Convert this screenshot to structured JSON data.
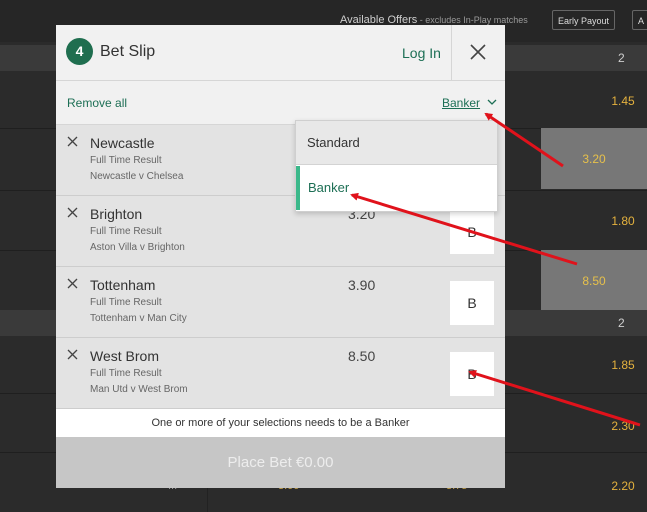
{
  "background": {
    "offers_label": "Available Offers",
    "offers_sub": " - excludes In-Play matches",
    "early_payout": "Early Payout",
    "edge_button": "A",
    "header_col": "2",
    "odds_rows": [
      "1.45",
      "3.20",
      "1.80",
      "8.50",
      "1.85",
      "2.30",
      "2.20"
    ],
    "bottom_fragments": [
      "...",
      "3.00",
      "3.75"
    ],
    "header2_col": "2"
  },
  "slip": {
    "count": "4",
    "title": "Bet Slip",
    "login": "Log In",
    "remove_all": "Remove all",
    "bet_type": "Banker",
    "selections": [
      {
        "team": "Newcastle",
        "market": "Full Time Result",
        "match": "Newcastle v Chelsea",
        "price": "",
        "banker_label": ""
      },
      {
        "team": "Brighton",
        "market": "Full Time Result",
        "match": "Aston Villa v Brighton",
        "price": "3.20",
        "banker_label": "B"
      },
      {
        "team": "Tottenham",
        "market": "Full Time Result",
        "match": "Tottenham v Man City",
        "price": "3.90",
        "banker_label": "B"
      },
      {
        "team": "West Brom",
        "market": "Full Time Result",
        "match": "Man Utd v West Brom",
        "price": "8.50",
        "banker_label": "B"
      }
    ],
    "warning": "One or more of your selections needs to be a Banker",
    "place_bet": "Place Bet  €0.00"
  },
  "dropdown": {
    "options": [
      "Standard",
      "Banker"
    ],
    "selected": "Banker"
  },
  "colors": {
    "accent": "#1d6f55",
    "badge": "#1f6e4f",
    "odds": "#e5b23e",
    "annotation_arrow": "#e0121b"
  }
}
